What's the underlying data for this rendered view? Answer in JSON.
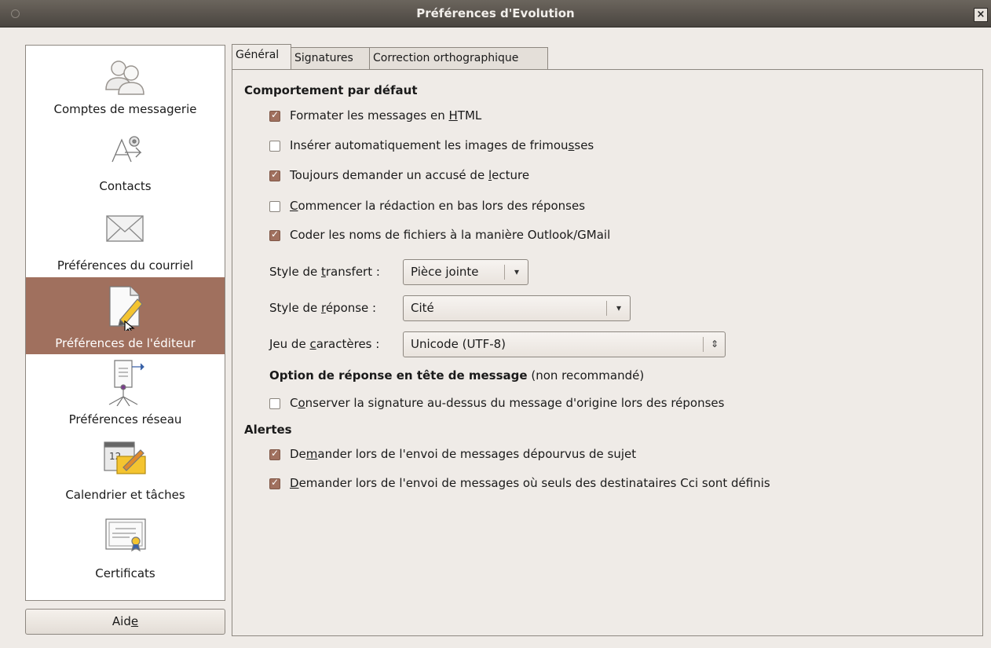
{
  "window": {
    "title": "Préférences d'Evolution",
    "close_symbol": "×"
  },
  "sidebar": {
    "items": [
      {
        "label": "Comptes de messagerie",
        "icon": "users-icon"
      },
      {
        "label": "Contacts",
        "icon": "address-book-icon"
      },
      {
        "label": "Préférences du courriel",
        "icon": "envelope-icon"
      },
      {
        "label": "Préférences de l'éditeur",
        "icon": "editor-pencil-icon",
        "selected": true
      },
      {
        "label": "Préférences réseau",
        "icon": "network-icon"
      },
      {
        "label": "Calendrier et tâches",
        "icon": "calendar-icon"
      },
      {
        "label": "Certificats",
        "icon": "certificate-icon"
      }
    ],
    "calendar_day": "12"
  },
  "help_button": {
    "pre": "Aid",
    "mnemonic": "e"
  },
  "tabs": [
    {
      "label": "Général",
      "active": true
    },
    {
      "label": "Signatures"
    },
    {
      "label": "Correction orthographique"
    }
  ],
  "general": {
    "default_behavior_heading": "Comportement par défaut",
    "html_format": {
      "pre": "Formater les messages en ",
      "mn": "H",
      "post": "TML",
      "checked": true
    },
    "smileys": {
      "pre": "Insérer automatiquement les images de frimou",
      "mn": "s",
      "post": "ses",
      "checked": false
    },
    "read_receipt": {
      "pre": "Toujours demander un accusé de ",
      "mn": "l",
      "post": "ecture",
      "checked": true
    },
    "reply_bottom": {
      "pre": "",
      "mn": "C",
      "post": "ommencer la rédaction en bas lors des réponses",
      "checked": false
    },
    "outlook_names": {
      "pre": "Coder les noms de fichiers à la manière Outlook/GMail",
      "mn": "",
      "post": "",
      "checked": true
    },
    "forward_style": {
      "pre": "Style de ",
      "mn": "t",
      "post": "ransfert :",
      "value": "Pièce jointe"
    },
    "reply_style": {
      "pre": "Style de ",
      "mn": "r",
      "post": "éponse  :",
      "value": "Cité"
    },
    "charset": {
      "pre": "Jeu de ",
      "mn": "c",
      "post": "aractères :",
      "value": "Unicode (UTF-8)"
    },
    "top_posting_heading": "Option de réponse en tête de message",
    "top_posting_note": "(non recommandé)",
    "keep_signature": {
      "pre": "C",
      "mn": "o",
      "post": "nserver la signature au-dessus du message d'origine lors des réponses",
      "checked": false
    },
    "alerts_heading": "Alertes",
    "alert_no_subject": {
      "pre": "De",
      "mn": "m",
      "post": "ander lors de l'envoi de messages dépourvus de sujet",
      "checked": true
    },
    "alert_bcc": {
      "pre": "",
      "mn": "D",
      "post": "emander lors de l'envoi de messages où seuls des destinataires Cci sont définis",
      "checked": true
    }
  },
  "colors": {
    "selection": "#a0705e",
    "accent_check": "#a0705e"
  }
}
